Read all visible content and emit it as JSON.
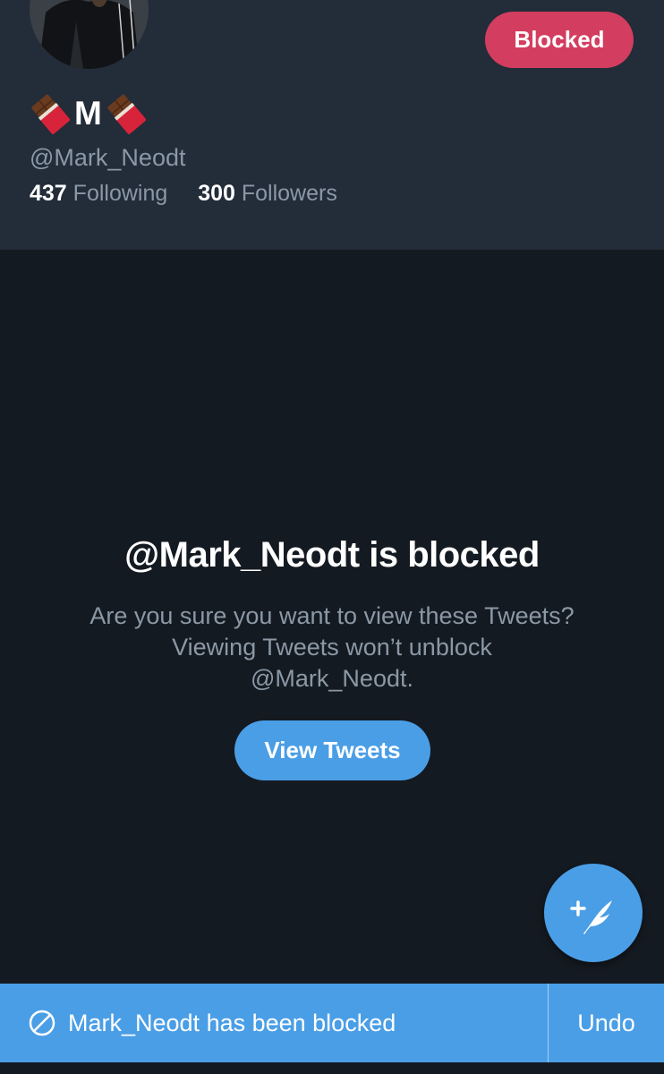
{
  "profile": {
    "display_name": "M",
    "handle": "@Mark_Neodt",
    "following_count": "437",
    "following_label": "Following",
    "followers_count": "300",
    "followers_label": "Followers",
    "block_button_label": "Blocked",
    "name_emoji": "chocolate-bar-icon"
  },
  "blocked_notice": {
    "title": "@Mark_Neodt is blocked",
    "message_line1": "Are you sure you want to view these Tweets?",
    "message_line2": "Viewing Tweets won’t unblock",
    "message_line3": "@Mark_Neodt.",
    "view_button_label": "View Tweets"
  },
  "snackbar": {
    "message": "Mark_Neodt has been blocked",
    "action_label": "Undo"
  },
  "colors": {
    "header_bg": "#232c39",
    "page_bg": "#141a21",
    "accent_blue": "#4a9ee6",
    "blocked_red": "#d33d5f",
    "secondary_text": "#8b98a6"
  }
}
